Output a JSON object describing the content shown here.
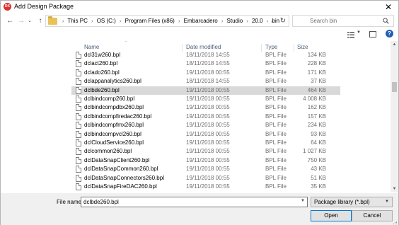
{
  "window": {
    "title": "Add Design Package",
    "app_icon_text": "DX",
    "close_glyph": "✕"
  },
  "nav": {
    "back": "←",
    "forward": "→",
    "history": "⌄",
    "up": "↑",
    "breadcrumb": [
      "This PC",
      "OS (C:)",
      "Program Files (x86)",
      "Embarcadero",
      "Studio",
      "20.0",
      "bin"
    ],
    "separator": "›",
    "refresh": "↻",
    "search_placeholder": "Search bin"
  },
  "list": {
    "columns": {
      "name": "Name",
      "date": "Date modified",
      "type": "Type",
      "size": "Size"
    },
    "sorted_column": "Name",
    "rows": [
      {
        "name": "dcl31w260.bpl",
        "date": "18/11/2018 14:55",
        "type": "BPL File",
        "size": "134 KB",
        "selected": false
      },
      {
        "name": "dclact260.bpl",
        "date": "18/11/2018 14:55",
        "type": "BPL File",
        "size": "228 KB",
        "selected": false
      },
      {
        "name": "dclado260.bpl",
        "date": "19/11/2018 00:55",
        "type": "BPL File",
        "size": "171 KB",
        "selected": false
      },
      {
        "name": "dclappanalytics260.bpl",
        "date": "18/11/2018 14:55",
        "type": "BPL File",
        "size": "37 KB",
        "selected": false
      },
      {
        "name": "dclbde260.bpl",
        "date": "19/11/2018 00:55",
        "type": "BPL File",
        "size": "464 KB",
        "selected": true
      },
      {
        "name": "dclbindcomp260.bpl",
        "date": "19/11/2018 00:55",
        "type": "BPL File",
        "size": "4 008 KB",
        "selected": false
      },
      {
        "name": "dclbindcompdbx260.bpl",
        "date": "19/11/2018 00:55",
        "type": "BPL File",
        "size": "162 KB",
        "selected": false
      },
      {
        "name": "dclbindcompfiredac260.bpl",
        "date": "19/11/2018 00:55",
        "type": "BPL File",
        "size": "157 KB",
        "selected": false
      },
      {
        "name": "dclbindcompfmx260.bpl",
        "date": "19/11/2018 00:55",
        "type": "BPL File",
        "size": "234 KB",
        "selected": false
      },
      {
        "name": "dclbindcompvcl260.bpl",
        "date": "19/11/2018 00:55",
        "type": "BPL File",
        "size": "93 KB",
        "selected": false
      },
      {
        "name": "dclCloudService260.bpl",
        "date": "19/11/2018 00:55",
        "type": "BPL File",
        "size": "64 KB",
        "selected": false
      },
      {
        "name": "dclcommon260.bpl",
        "date": "19/11/2018 00:55",
        "type": "BPL File",
        "size": "1 027 KB",
        "selected": false
      },
      {
        "name": "dclDataSnapClient260.bpl",
        "date": "19/11/2018 00:55",
        "type": "BPL File",
        "size": "750 KB",
        "selected": false
      },
      {
        "name": "dclDataSnapCommon260.bpl",
        "date": "19/11/2018 00:55",
        "type": "BPL File",
        "size": "43 KB",
        "selected": false
      },
      {
        "name": "dclDataSnapConnectors260.bpl",
        "date": "19/11/2018 00:55",
        "type": "BPL File",
        "size": "51 KB",
        "selected": false
      },
      {
        "name": "dclDataSnapFireDAC260.bpl",
        "date": "19/11/2018 00:55",
        "type": "BPL File",
        "size": "35 KB",
        "selected": false
      }
    ]
  },
  "footer": {
    "file_name_label": "File name:",
    "file_name_value": "dclbde260.bpl",
    "filter_value": "Package library  (*.bpl)",
    "open_label": "Open",
    "cancel_label": "Cancel"
  },
  "colors": {
    "selected_row": "#d9d9d9",
    "header_text": "#4c607a",
    "focus_border": "#0078d7"
  }
}
